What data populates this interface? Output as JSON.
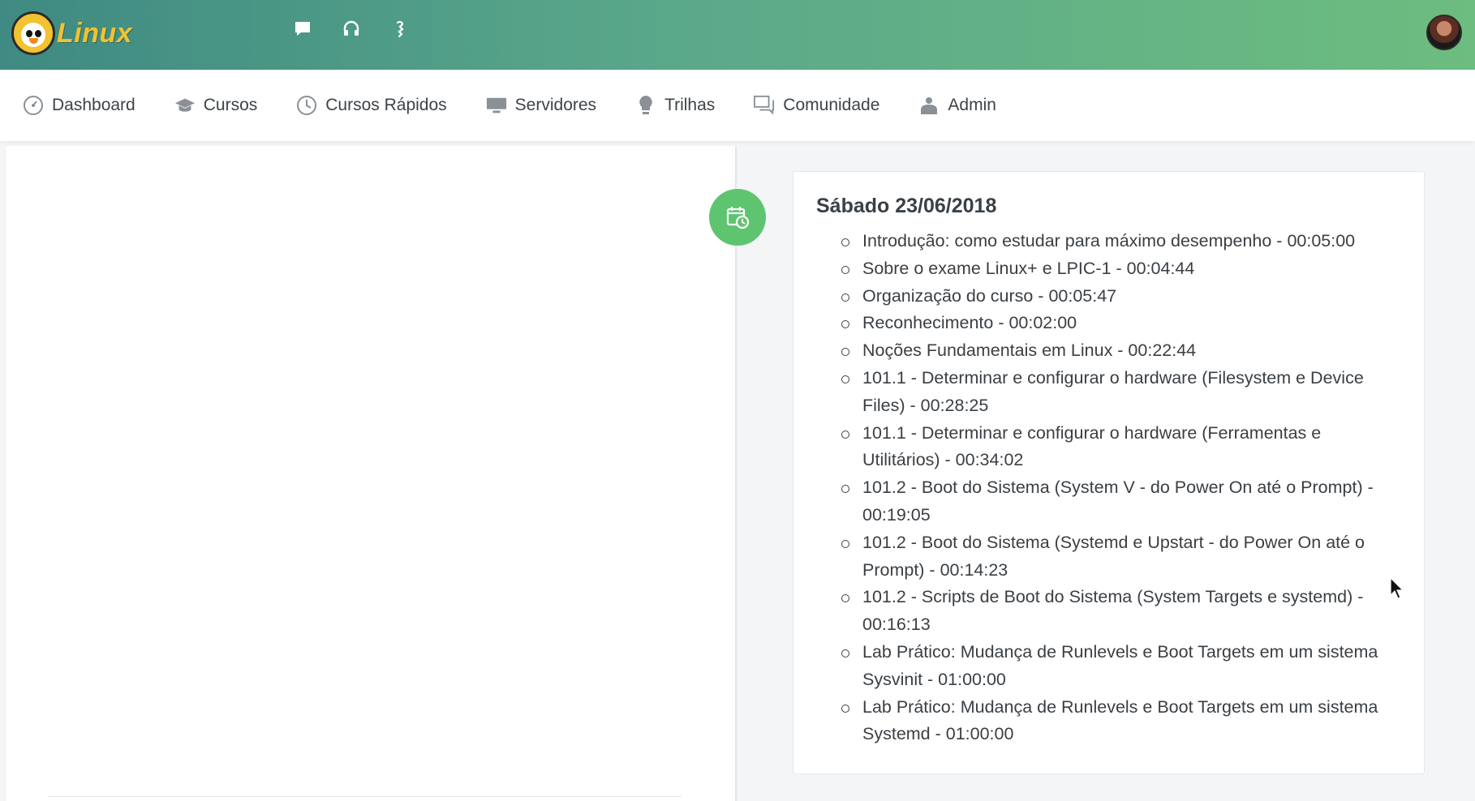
{
  "header": {
    "logo_text": "Linux",
    "icons": [
      "chat-icon",
      "headset-icon",
      "hand-icon"
    ],
    "colors": {
      "gradient_start": "#3f8a82",
      "gradient_end": "#6dbd80"
    }
  },
  "nav": {
    "items": [
      {
        "label": "Dashboard",
        "icon": "dashboard-gauge-icon"
      },
      {
        "label": "Cursos",
        "icon": "graduation-cap-icon"
      },
      {
        "label": "Cursos Rápidos",
        "icon": "clock-icon"
      },
      {
        "label": "Servidores",
        "icon": "monitor-icon"
      },
      {
        "label": "Trilhas",
        "icon": "lightbulb-icon"
      },
      {
        "label": "Comunidade",
        "icon": "chat-bubbles-icon"
      },
      {
        "label": "Admin",
        "icon": "admin-icon"
      }
    ]
  },
  "timeline": {
    "badge_icon": "calendar-clock-icon",
    "badge_color": "#5fc46f",
    "day_title": "Sábado 23/06/2018",
    "lessons": [
      "Introdução: como estudar para máximo desempenho - 00:05:00",
      "Sobre o exame Linux+ e LPIC-1 - 00:04:44",
      "Organização do curso - 00:05:47",
      "Reconhecimento - 00:02:00",
      "Noções Fundamentais em Linux - 00:22:44",
      "101.1 - Determinar e configurar o hardware (Filesystem e Device Files) - 00:28:25",
      "101.1 - Determinar e configurar o hardware (Ferramentas e Utilitários) - 00:34:02",
      "101.2 - Boot do Sistema (System V - do Power On até o Prompt) - 00:19:05",
      "101.2 - Boot do Sistema (Systemd e Upstart - do Power On até o Prompt) - 00:14:23",
      "101.2 - Scripts de Boot do Sistema (System Targets e systemd) - 00:16:13",
      "Lab Prático: Mudança de Runlevels e Boot Targets em um sistema Sysvinit - 01:00:00",
      "Lab Prático: Mudança de Runlevels e Boot Targets em um sistema Systemd - 01:00:00"
    ]
  }
}
